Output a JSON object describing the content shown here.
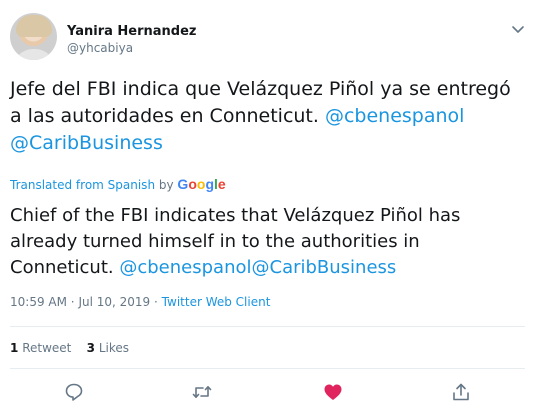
{
  "author": {
    "display_name": "Yanira Hernandez",
    "handle": "@yhcabiya"
  },
  "tweet": {
    "text_plain": "Jefe del FBI indica que Velázquez Piñol ya se entregó a las autoridades en Conneticut.",
    "mention_1": "@cbenespanol",
    "mention_2": "@CaribBusiness"
  },
  "translation": {
    "label": "Translated from Spanish",
    "by": "by",
    "provider": "Google",
    "text_plain": "Chief of the FBI indicates that Velázquez Piñol has already turned himself in to the authorities in Conneticut.",
    "mention_1": "@cbenespanol",
    "mention_2": "@CaribBusiness"
  },
  "meta": {
    "time": "10:59 AM",
    "separator": "·",
    "date": "Jul 10, 2019",
    "client": "Twitter Web Client"
  },
  "stats": {
    "retweets_count": "1",
    "retweets_label": "Retweet",
    "likes_count": "3",
    "likes_label": "Likes"
  },
  "actions": [
    {
      "icon": "reply-icon"
    },
    {
      "icon": "retweet-icon"
    },
    {
      "icon": "like-icon",
      "active": true,
      "color": "#e0245e"
    },
    {
      "icon": "share-icon"
    }
  ],
  "colors": {
    "link": "#1b95e0",
    "secondary_text": "#657786",
    "primary_text": "#14171a",
    "like_active": "#e0245e",
    "divider": "#e6ecf0"
  }
}
